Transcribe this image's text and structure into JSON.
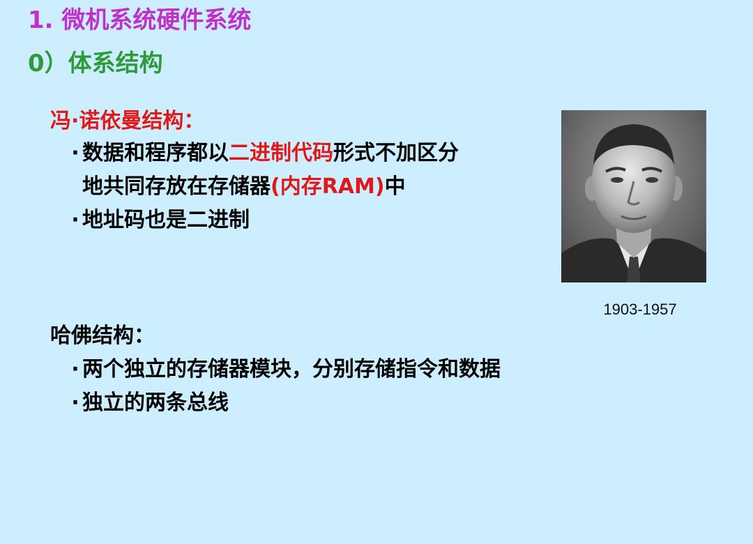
{
  "title": {
    "text": "1. 微机系统硬件系统",
    "color": "#c030c8"
  },
  "subtitle": {
    "text": "0）体系结构",
    "color": "#2e9a3a"
  },
  "von_neumann": {
    "heading": "冯·诺依曼结构：",
    "heading_color": "#e01818",
    "bullet": "·",
    "item1_part1": "数据和程序都以",
    "item1_highlight": "二进制代码",
    "item1_part2": "形式不加区分",
    "item1_line2_part1": "地共同存放在存储器",
    "item1_line2_highlight": "(内存RAM)",
    "item1_line2_part2": "中",
    "item2": "地址码也是二进制",
    "highlight_color": "#e01818"
  },
  "portrait": {
    "caption": "1903-1957"
  },
  "harvard": {
    "heading": "哈佛结构：",
    "bullet": "·",
    "item1": "两个独立的存储器模块，分别存储指令和数据",
    "item2": "独立的两条总线"
  }
}
